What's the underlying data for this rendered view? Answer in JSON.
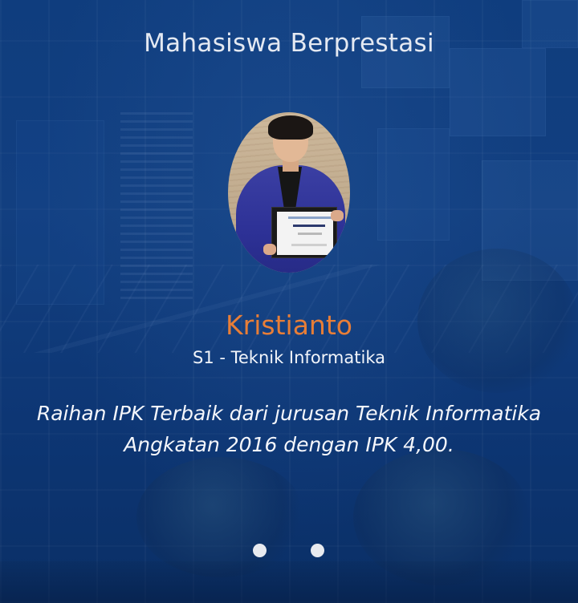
{
  "slide": {
    "heading": "Mahasiswa Berprestasi",
    "student_name": "Kristianto",
    "program": "S1 - Teknik Informatika",
    "achievement_line1": "Raihan IPK Terbaik dari jurusan Teknik Informatika",
    "achievement_line2": "Angkatan 2016 dengan IPK 4,00.",
    "photo_icon": "student-portrait-with-certificate"
  },
  "carousel": {
    "indicator_count": 2
  },
  "colors": {
    "background": "#0f3d7e",
    "name_accent": "#e87e37",
    "text": "#f2f5fa",
    "indicator": "#e8eaef"
  }
}
